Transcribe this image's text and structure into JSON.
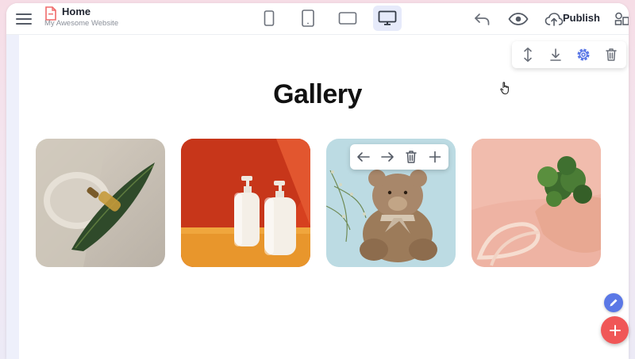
{
  "header": {
    "page_title": "Home",
    "site_name": "My Awesome Website",
    "publish_label": "Publish",
    "devices": [
      "phone-icon",
      "tablet-portrait-icon",
      "tablet-landscape-icon",
      "desktop-icon"
    ],
    "active_device": "desktop-icon"
  },
  "section_toolbar": {
    "icons": [
      "move-vertical-icon",
      "download-icon",
      "gear-icon",
      "trash-icon"
    ]
  },
  "gallery": {
    "title": "Gallery",
    "tiles": [
      "leaf-serum-image",
      "lotion-bottles-image",
      "teddy-bear-image",
      "plant-tote-image"
    ]
  },
  "image_toolbar": {
    "icons": [
      "arrow-left-icon",
      "arrow-right-icon",
      "trash-icon",
      "plus-icon"
    ]
  },
  "colors": {
    "accent": "#5b78e6",
    "fab_add": "#f05757",
    "active_device_bg": "#e6eafa"
  }
}
